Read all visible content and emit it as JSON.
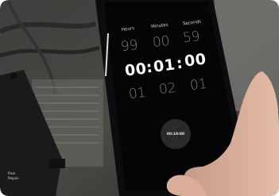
{
  "timer": {
    "units": [
      "Hours",
      "Minutes",
      "Seconds"
    ],
    "prev": [
      "99",
      "00",
      "59"
    ],
    "current": [
      "00",
      "01",
      "00"
    ],
    "next": [
      "01",
      "02",
      "01"
    ],
    "separator": ":",
    "preset_button": "00:10:00"
  },
  "device_label": {
    "line1": "Pixel",
    "line2": "Region"
  }
}
